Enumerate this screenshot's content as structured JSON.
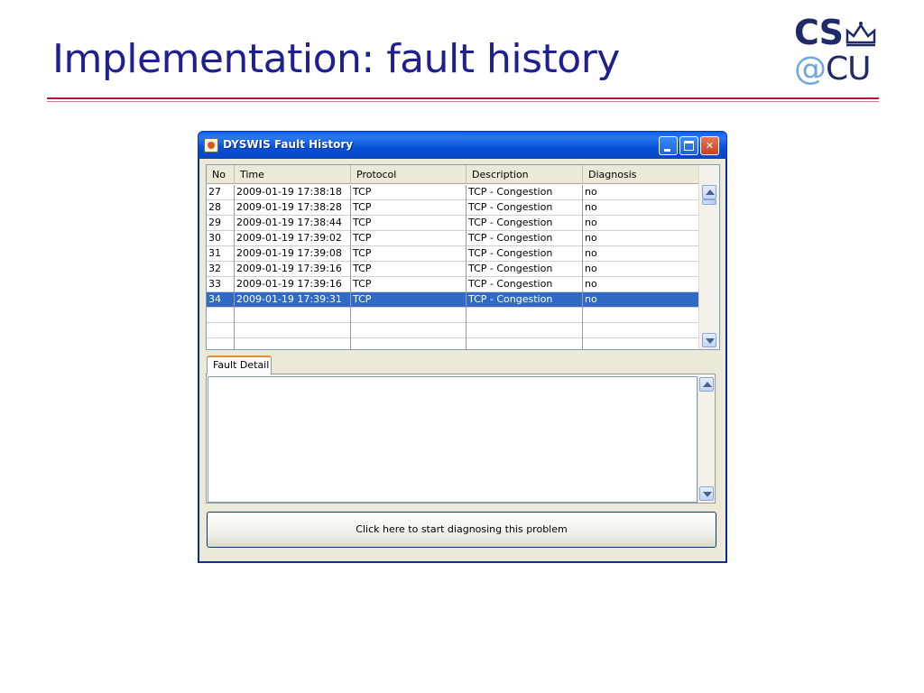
{
  "slide": {
    "title": "Implementation: fault history",
    "logo_top": "CS",
    "logo_at": "@",
    "logo_bottom": "CU"
  },
  "window": {
    "title": "DYSWIS Fault History",
    "controls": {
      "minimize": "",
      "maximize": "",
      "close": "✕"
    }
  },
  "table": {
    "columns": [
      "No",
      "Time",
      "Protocol",
      "Description",
      "Diagnosis"
    ],
    "rows": [
      [
        "27",
        "2009-01-19 17:38:18",
        "TCP",
        "TCP - Congestion",
        "no"
      ],
      [
        "28",
        "2009-01-19 17:38:28",
        "TCP",
        "TCP - Congestion",
        "no"
      ],
      [
        "29",
        "2009-01-19 17:38:44",
        "TCP",
        "TCP - Congestion",
        "no"
      ],
      [
        "30",
        "2009-01-19 17:39:02",
        "TCP",
        "TCP - Congestion",
        "no"
      ],
      [
        "31",
        "2009-01-19 17:39:08",
        "TCP",
        "TCP - Congestion",
        "no"
      ],
      [
        "32",
        "2009-01-19 17:39:16",
        "TCP",
        "TCP - Congestion",
        "no"
      ],
      [
        "33",
        "2009-01-19 17:39:16",
        "TCP",
        "TCP - Congestion",
        "no"
      ],
      [
        "34",
        "2009-01-19 17:39:31",
        "TCP",
        "TCP - Congestion",
        "no"
      ]
    ],
    "selected_row_index": 7,
    "empty_rows": 3
  },
  "tabs": [
    {
      "label": "Fault Detail",
      "active": true
    }
  ],
  "detail": {
    "text": ""
  },
  "diagnose_button": {
    "label": "Click here to start diagnosing this problem"
  },
  "colors": {
    "title": "#1f1f8f",
    "rule": "#b01a3a",
    "titlebar": "#0551d6",
    "selection": "#316ac5",
    "tab_accent": "#e68b2c"
  }
}
